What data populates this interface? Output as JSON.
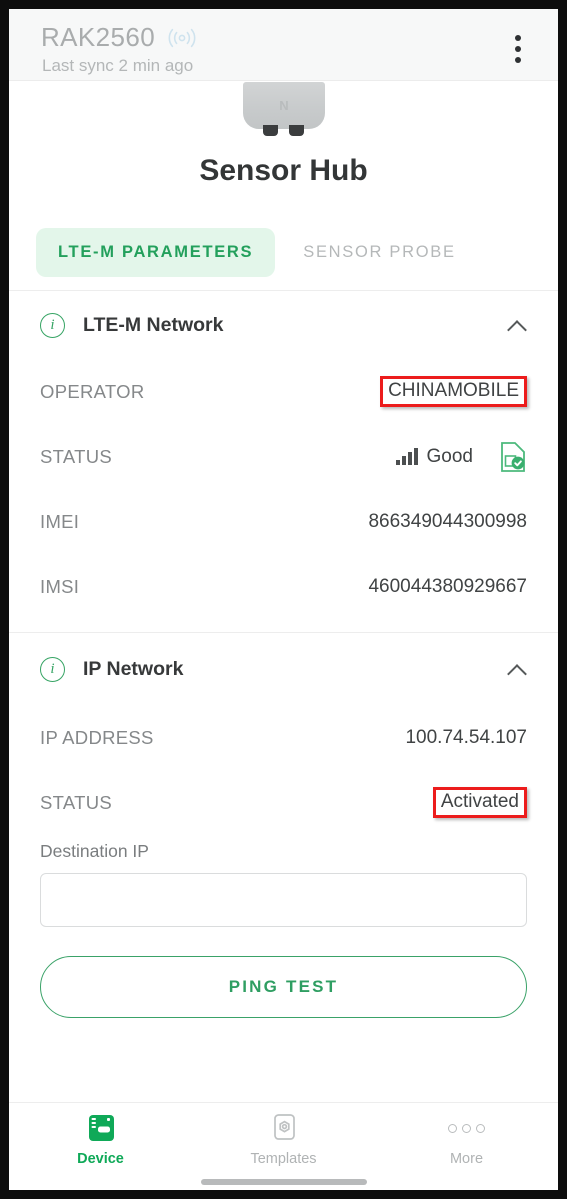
{
  "appbar": {
    "device_id": "RAK2560",
    "broadcast_icon": "broadcast-icon",
    "last_sync": "Last sync 2 min ago",
    "menu_icon": "kebab-menu-icon"
  },
  "hero": {
    "device_image": "sensor-hub-device-image",
    "nfc_logo": "N",
    "title": "Sensor Hub"
  },
  "tabs": [
    {
      "label": "LTE-M PARAMETERS",
      "active": true
    },
    {
      "label": "SENSOR PROBE",
      "active": false
    }
  ],
  "sections": [
    {
      "title": "LTE-M Network",
      "info_icon": "info-icon",
      "collapse_icon": "chevron-up-icon",
      "rows": [
        {
          "label": "OPERATOR",
          "value": "CHINAMOBILE",
          "annotated": true
        },
        {
          "label": "STATUS",
          "value": "Good",
          "signal_icon": "signal-bars-icon",
          "trailing_icon": "sim-card-check-icon"
        },
        {
          "label": "IMEI",
          "value": "866349044300998"
        },
        {
          "label": "IMSI",
          "value": "460044380929667"
        }
      ]
    },
    {
      "title": "IP Network",
      "info_icon": "info-icon",
      "collapse_icon": "chevron-up-icon",
      "rows": [
        {
          "label": "IP ADDRESS",
          "value": "100.74.54.107"
        },
        {
          "label": "STATUS",
          "value": "Activated",
          "annotated": true
        }
      ]
    }
  ],
  "form": {
    "destination_ip_label": "Destination IP",
    "destination_ip_value": "",
    "destination_ip_placeholder": "",
    "ping_button_label": "PING TEST"
  },
  "bottom_nav": [
    {
      "label": "Device",
      "icon": "device-chip-icon",
      "active": true
    },
    {
      "label": "Templates",
      "icon": "template-hexagon-icon",
      "active": false
    },
    {
      "label": "More",
      "icon": "more-dots-icon",
      "active": false
    }
  ],
  "colors": {
    "accent_green": "#0fa958",
    "tab_green": "#23a05c",
    "tab_pill_bg": "#e3f6ea",
    "annotation_red": "#ec1c1c",
    "label_gray": "#85888a",
    "value_dark": "#404344"
  }
}
